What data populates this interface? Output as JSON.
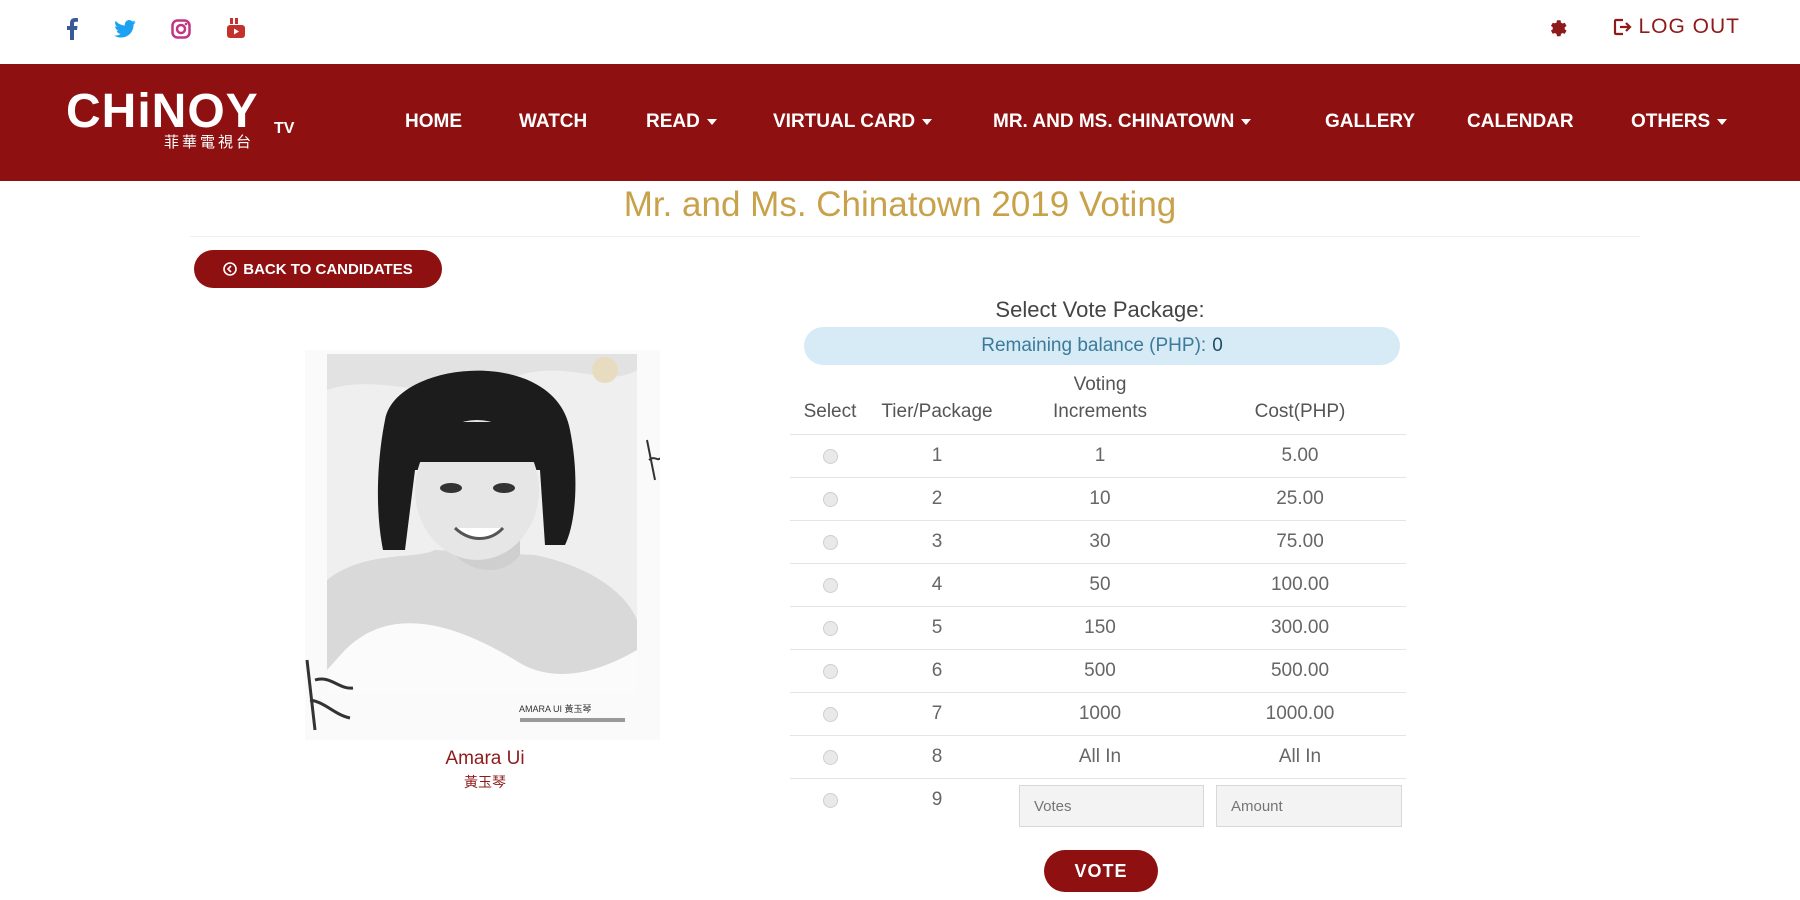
{
  "social": [
    {
      "name": "facebook-icon",
      "color": "#3b5998"
    },
    {
      "name": "twitter-icon",
      "color": "#1da1f2"
    },
    {
      "name": "instagram-icon",
      "color": "#c13584"
    },
    {
      "name": "youtube-icon",
      "color": "#c4302b"
    }
  ],
  "topbar": {
    "logout_label": "LOG OUT"
  },
  "logo": {
    "main": "CHiNOY",
    "tv": "TV",
    "sub": "菲華電視台"
  },
  "nav": [
    {
      "label": "HOME",
      "dropdown": false
    },
    {
      "label": "WATCH",
      "dropdown": false
    },
    {
      "label": "READ",
      "dropdown": true
    },
    {
      "label": "VIRTUAL CARD",
      "dropdown": true
    },
    {
      "label": "MR. AND MS. CHINATOWN",
      "dropdown": true
    },
    {
      "label": "GALLERY",
      "dropdown": false
    },
    {
      "label": "CALENDAR",
      "dropdown": false
    },
    {
      "label": "OTHERS",
      "dropdown": true
    }
  ],
  "page": {
    "title": "Mr. and Ms. Chinatown 2019 Voting",
    "back_label": "BACK TO CANDIDATES",
    "select_label": "Select Vote Package:",
    "balance_label": "Remaining balance (PHP):",
    "balance_value": "0",
    "vote_label": "VOTE"
  },
  "candidate": {
    "name": "Amara Ui",
    "chinese_name": "黃玉琴",
    "photo_caption": "AMARA UI 黃玉琴"
  },
  "table": {
    "headers": {
      "select": "Select",
      "tier": "Tier/Package",
      "increments_1": "Voting",
      "increments_2": "Increments",
      "cost": "Cost(PHP)"
    },
    "rows": [
      {
        "tier": "1",
        "increments": "1",
        "cost": "5.00"
      },
      {
        "tier": "2",
        "increments": "10",
        "cost": "25.00"
      },
      {
        "tier": "3",
        "increments": "30",
        "cost": "75.00"
      },
      {
        "tier": "4",
        "increments": "50",
        "cost": "100.00"
      },
      {
        "tier": "5",
        "increments": "150",
        "cost": "300.00"
      },
      {
        "tier": "6",
        "increments": "500",
        "cost": "500.00"
      },
      {
        "tier": "7",
        "increments": "1000",
        "cost": "1000.00"
      },
      {
        "tier": "8",
        "increments": "All In",
        "cost": "All In"
      }
    ],
    "custom_row": {
      "tier": "9",
      "votes_placeholder": "Votes",
      "amount_placeholder": "Amount"
    }
  }
}
